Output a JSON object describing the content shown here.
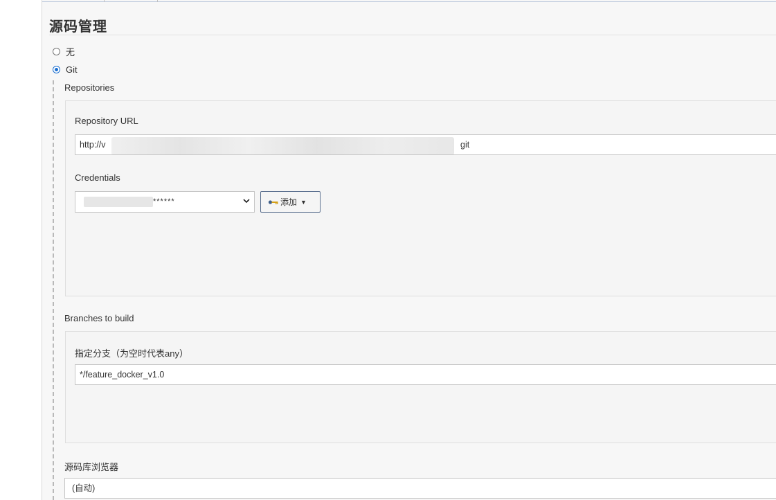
{
  "section": {
    "title": "源码管理"
  },
  "scm_options": [
    {
      "label": "无",
      "checked": false
    },
    {
      "label": "Git",
      "checked": true
    }
  ],
  "repositories": {
    "heading": "Repositories",
    "url_label": "Repository URL",
    "url_value_prefix": "http://v",
    "url_value_suffix": "git",
    "credentials_label": "Credentials",
    "credentials_value": "******",
    "add_button_label": "添加"
  },
  "branches": {
    "heading": "Branches to build",
    "branch_label": "指定分支（为空时代表any）",
    "branch_value": "*/feature_docker_v1.0"
  },
  "browser": {
    "label": "源码库浏览器",
    "value": "(自动)"
  },
  "colors": {
    "accent": "#1a6fd1",
    "panel_bg": "#f7f7f7",
    "button_border": "#5a6f8e"
  },
  "icons": [
    "radio-icon",
    "key-icon",
    "chevron-down-icon",
    "caret-down-icon"
  ]
}
